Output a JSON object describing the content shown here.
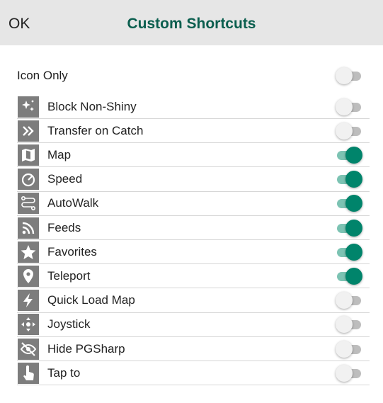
{
  "header": {
    "ok_label": "OK",
    "title": "Custom Shortcuts"
  },
  "icon_only": {
    "label": "Icon Only",
    "enabled": false
  },
  "colors": {
    "accent": "#0a5e4e",
    "toggle_on": "#00846b",
    "icon_bg": "#7d7d7d"
  },
  "items": [
    {
      "label": "Block Non-Shiny",
      "icon": "sparkle-icon",
      "enabled": false
    },
    {
      "label": "Transfer on Catch",
      "icon": "double-chevron-icon",
      "enabled": false
    },
    {
      "label": "Map",
      "icon": "map-icon",
      "enabled": true
    },
    {
      "label": "Speed",
      "icon": "speedometer-icon",
      "enabled": true
    },
    {
      "label": "AutoWalk",
      "icon": "route-icon",
      "enabled": true
    },
    {
      "label": "Feeds",
      "icon": "rss-icon",
      "enabled": true
    },
    {
      "label": "Favorites",
      "icon": "star-icon",
      "enabled": true
    },
    {
      "label": "Teleport",
      "icon": "location-pin-icon",
      "enabled": true
    },
    {
      "label": "Quick Load Map",
      "icon": "lightning-icon",
      "enabled": false
    },
    {
      "label": "Joystick",
      "icon": "joystick-icon",
      "enabled": false
    },
    {
      "label": "Hide PGSharp",
      "icon": "eye-off-icon",
      "enabled": false
    },
    {
      "label": "Tap to",
      "icon": "tap-hand-icon",
      "enabled": false
    }
  ]
}
